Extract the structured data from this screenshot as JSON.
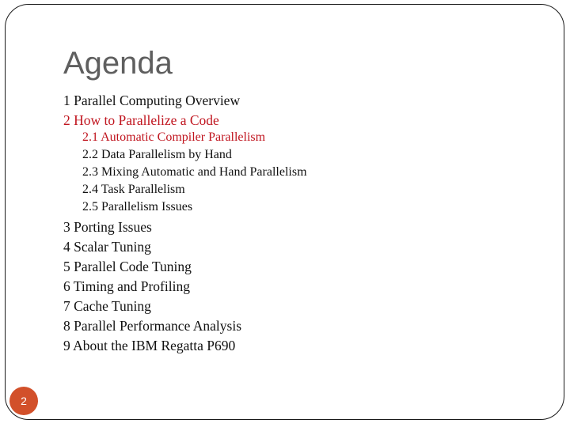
{
  "slide": {
    "title": "Agenda",
    "page_number": "2",
    "colors": {
      "title": "#5f5f5f",
      "highlight": "#c0141e",
      "badge": "#d2502a",
      "text": "#111111"
    },
    "items": [
      {
        "label": "1 Parallel Computing Overview",
        "level": 1,
        "highlight": false
      },
      {
        "label": "2 How to Parallelize a Code",
        "level": 1,
        "highlight": true
      },
      {
        "label": "2.1 Automatic Compiler Parallelism",
        "level": 2,
        "highlight": true
      },
      {
        "label": "2.2 Data Parallelism by Hand",
        "level": 2,
        "highlight": false
      },
      {
        "label": "2.3 Mixing Automatic and Hand Parallelism",
        "level": 2,
        "highlight": false
      },
      {
        "label": "2.4 Task Parallelism",
        "level": 2,
        "highlight": false
      },
      {
        "label": "2.5 Parallelism Issues",
        "level": 2,
        "highlight": false
      },
      {
        "label": "3 Porting Issues",
        "level": 1,
        "highlight": false
      },
      {
        "label": "4 Scalar Tuning",
        "level": 1,
        "highlight": false
      },
      {
        "label": "5 Parallel Code Tuning",
        "level": 1,
        "highlight": false
      },
      {
        "label": "6 Timing and Profiling",
        "level": 1,
        "highlight": false
      },
      {
        "label": "7 Cache Tuning",
        "level": 1,
        "highlight": false
      },
      {
        "label": "8 Parallel Performance Analysis",
        "level": 1,
        "highlight": false
      },
      {
        "label": "9 About the IBM Regatta P690",
        "level": 1,
        "highlight": false
      }
    ]
  }
}
